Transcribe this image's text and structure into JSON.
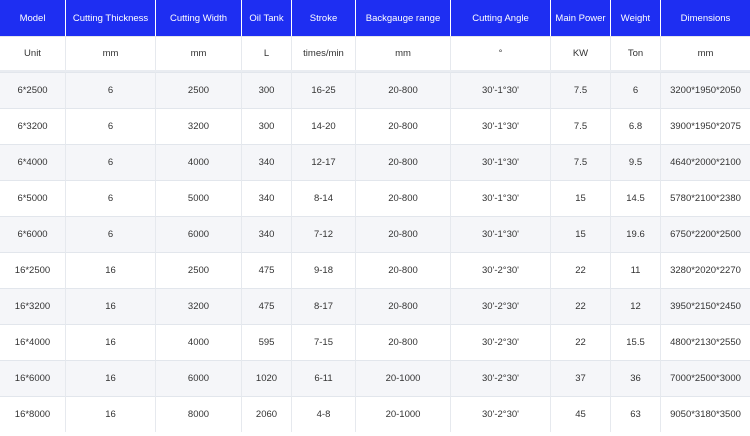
{
  "table": {
    "headers": [
      "Model",
      "Cutting Thickness",
      "Cutting Width",
      "Oil Tank",
      "Stroke",
      "Backgauge range",
      "Cutting Angle",
      "Main Power",
      "Weight",
      "Dimensions"
    ],
    "units": [
      "Unit",
      "mm",
      "mm",
      "L",
      "times/min",
      "mm",
      "°",
      "KW",
      "Ton",
      "mm"
    ],
    "rows": [
      [
        "6*2500",
        "6",
        "2500",
        "300",
        "16-25",
        "20-800",
        "30'-1°30'",
        "7.5",
        "6",
        "3200*1950*2050"
      ],
      [
        "6*3200",
        "6",
        "3200",
        "300",
        "14-20",
        "20-800",
        "30'-1°30'",
        "7.5",
        "6.8",
        "3900*1950*2075"
      ],
      [
        "6*4000",
        "6",
        "4000",
        "340",
        "12-17",
        "20-800",
        "30'-1°30'",
        "7.5",
        "9.5",
        "4640*2000*2100"
      ],
      [
        "6*5000",
        "6",
        "5000",
        "340",
        "8-14",
        "20-800",
        "30'-1°30'",
        "15",
        "14.5",
        "5780*2100*2380"
      ],
      [
        "6*6000",
        "6",
        "6000",
        "340",
        "7-12",
        "20-800",
        "30'-1°30'",
        "15",
        "19.6",
        "6750*2200*2500"
      ],
      [
        "16*2500",
        "16",
        "2500",
        "475",
        "9-18",
        "20-800",
        "30'-2°30'",
        "22",
        "11",
        "3280*2020*2270"
      ],
      [
        "16*3200",
        "16",
        "3200",
        "475",
        "8-17",
        "20-800",
        "30'-2°30'",
        "22",
        "12",
        "3950*2150*2450"
      ],
      [
        "16*4000",
        "16",
        "4000",
        "595",
        "7-15",
        "20-800",
        "30'-2°30'",
        "22",
        "15.5",
        "4800*2130*2550"
      ],
      [
        "16*6000",
        "16",
        "6000",
        "1020",
        "6-11",
        "20-1000",
        "30'-2°30'",
        "37",
        "36",
        "7000*2500*3000"
      ],
      [
        "16*8000",
        "16",
        "8000",
        "2060",
        "4-8",
        "20-1000",
        "30'-2°30'",
        "45",
        "63",
        "9050*3180*3500"
      ]
    ]
  }
}
